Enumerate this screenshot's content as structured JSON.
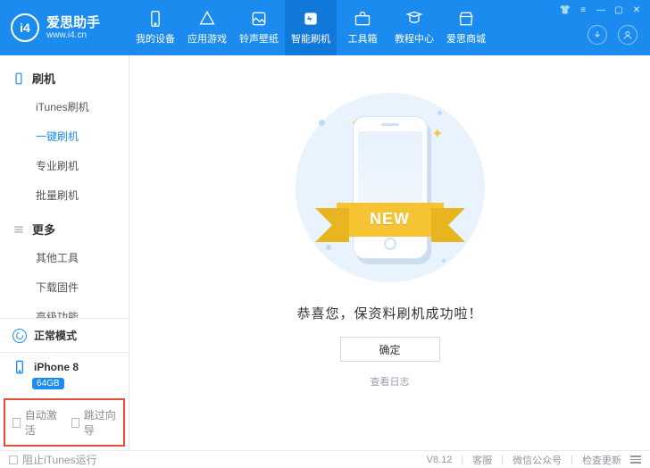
{
  "app": {
    "name": "爱思助手",
    "url": "www.i4.cn",
    "logo_text": "i4"
  },
  "tabs": [
    {
      "label": "我的设备",
      "icon": "device-icon"
    },
    {
      "label": "应用游戏",
      "icon": "apps-icon"
    },
    {
      "label": "铃声壁纸",
      "icon": "media-icon"
    },
    {
      "label": "智能刷机",
      "icon": "flash-icon",
      "active": true
    },
    {
      "label": "工具箱",
      "icon": "toolbox-icon"
    },
    {
      "label": "教程中心",
      "icon": "help-icon"
    },
    {
      "label": "爱思商城",
      "icon": "store-icon"
    }
  ],
  "sidebar": {
    "groups": [
      {
        "title": "刷机",
        "icon": "flash-group-icon",
        "items": [
          {
            "label": "iTunes刷机"
          },
          {
            "label": "一键刷机",
            "active": true
          },
          {
            "label": "专业刷机"
          },
          {
            "label": "批量刷机"
          }
        ]
      },
      {
        "title": "更多",
        "icon": "more-group-icon",
        "items": [
          {
            "label": "其他工具"
          },
          {
            "label": "下载固件"
          },
          {
            "label": "高级功能"
          }
        ]
      }
    ],
    "mode_label": "正常模式",
    "device": {
      "name": "iPhone 8",
      "storage": "64GB"
    },
    "footer_checks": [
      {
        "label": "自动激活"
      },
      {
        "label": "跳过向导"
      }
    ]
  },
  "main": {
    "ribbon_text": "NEW",
    "message": "恭喜您，保资料刷机成功啦！",
    "ok_label": "确定",
    "log_link": "查看日志"
  },
  "statusbar": {
    "block_itunes": "阻止iTunes运行",
    "version": "V8.12",
    "links": [
      "客服",
      "微信公众号",
      "检查更新"
    ]
  }
}
